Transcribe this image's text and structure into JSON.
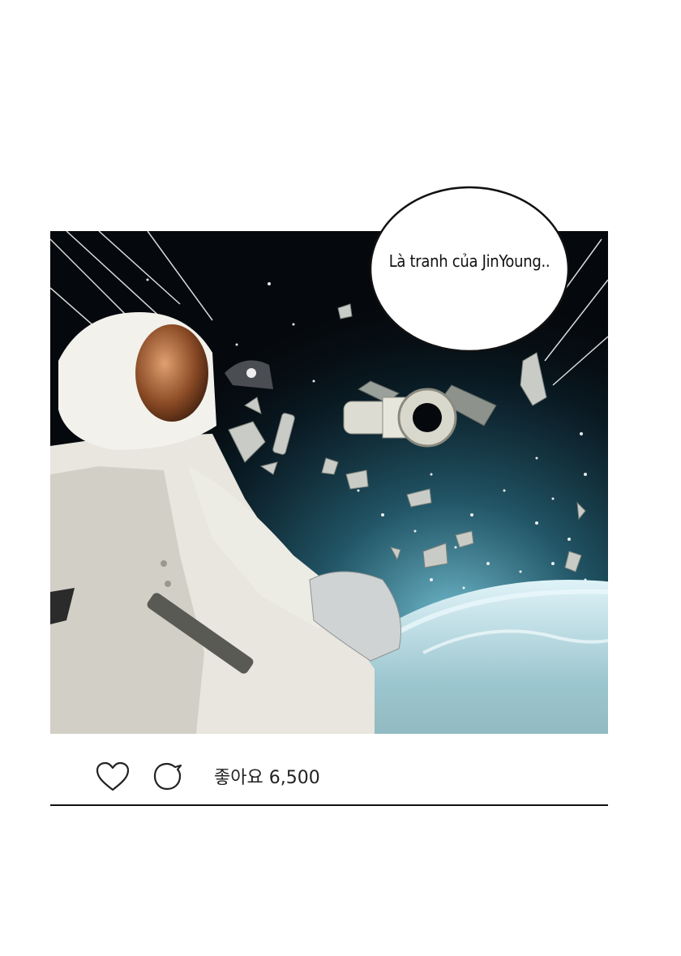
{
  "speech_bubble": {
    "text": "Là tranh của JinYoung.."
  },
  "post_actions": {
    "like_icon": "heart-outline-icon",
    "comment_icon": "speech-bubble-outline-icon",
    "likes_label": "좋아요 6,500"
  },
  "colors": {
    "space": "#05080c",
    "earth_glow": "#7fd2e6",
    "suit": "#e8e6de",
    "visor": "#b06a3a"
  }
}
